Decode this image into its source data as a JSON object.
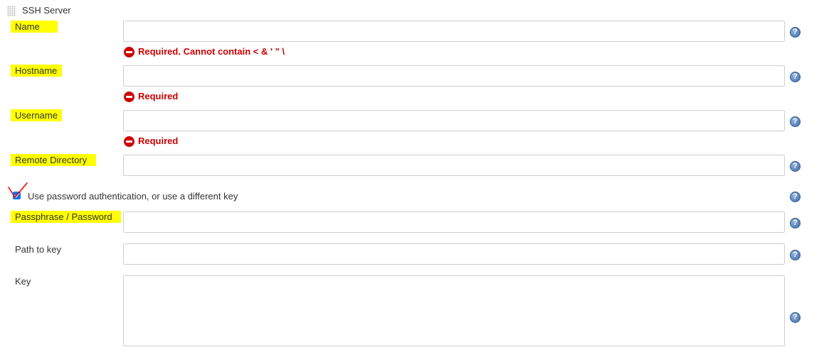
{
  "section": {
    "title": "SSH Server"
  },
  "fields": {
    "name": {
      "label": "Name",
      "value": "",
      "error": "Required. Cannot contain < & ' \" \\"
    },
    "hostname": {
      "label": "Hostname",
      "value": "",
      "error": "Required"
    },
    "username": {
      "label": "Username",
      "value": "",
      "error": "Required"
    },
    "remote_directory": {
      "label": "Remote Directory",
      "value": ""
    },
    "passphrase": {
      "label": "Passphrase / Password",
      "value": ""
    },
    "path_to_key": {
      "label": "Path to key",
      "value": ""
    },
    "key": {
      "label": "Key",
      "value": ""
    }
  },
  "checkbox": {
    "label": "Use password authentication, or use a different key",
    "checked": true
  },
  "help": {
    "glyph": "?",
    "icon": "help-icon"
  },
  "colors": {
    "highlight": "#ffff00",
    "error": "#cc0000",
    "help": "#3f6ea8",
    "annotation": "#ff0000"
  }
}
